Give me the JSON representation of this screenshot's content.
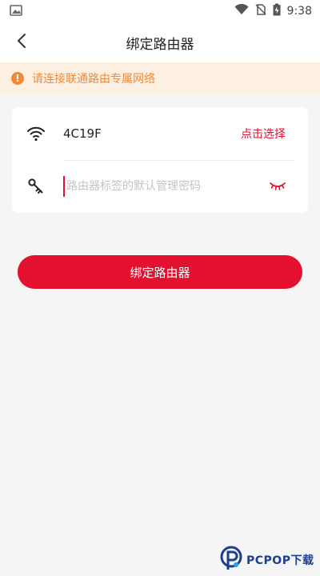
{
  "status_bar": {
    "time": "9:38",
    "icons": [
      "image-icon",
      "wifi-icon",
      "no-sim-icon",
      "battery-charging-icon"
    ]
  },
  "header": {
    "title": "绑定路由器",
    "back_icon": "chevron-left-icon"
  },
  "notice": {
    "icon": "alert-icon",
    "icon_glyph": "!",
    "text": "请连接联通路由专属网络",
    "color": "#f08a3a",
    "background": "#fdf0e2"
  },
  "form": {
    "wifi": {
      "icon": "wifi-icon",
      "ssid": "4C19F",
      "select_label": "点击选择"
    },
    "password": {
      "icon": "key-icon",
      "value": "",
      "placeholder": "路由器标签的默认管理密码",
      "toggle_icon": "eye-closed-icon"
    }
  },
  "bind_button": {
    "label": "绑定路由器",
    "color": "#e3102f"
  },
  "watermark": {
    "text": "PCPOP下载"
  }
}
